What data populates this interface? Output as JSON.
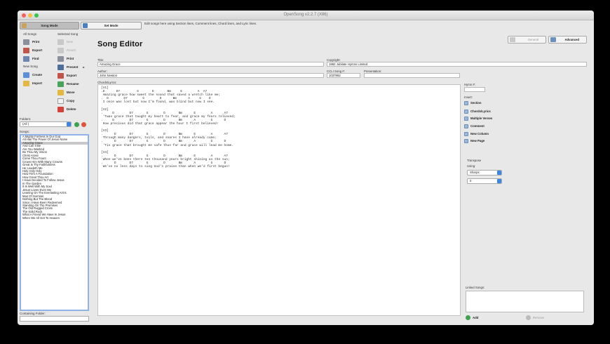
{
  "window": {
    "title": "OpenSong v2.2.7 (X86)"
  },
  "modes": {
    "song_mode": "Song Mode",
    "set_mode": "Set Mode",
    "hint": "Edit songs here using Section lines, Comment lines, Chord lines, and Lyric lines."
  },
  "left": {
    "all_songs": "All Songs",
    "selected_song": "Selected Song",
    "all_buttons": [
      "Print",
      "Export",
      "Find"
    ],
    "new_song": "New Song",
    "new_buttons": [
      "Create",
      "Import"
    ],
    "selected_buttons": [
      "New",
      "Revert",
      "Print",
      "Present",
      "Export",
      "Rename",
      "Move",
      "Copy",
      "Delete"
    ],
    "folders_label": "Folders:",
    "folder_value": "(All )",
    "songs_label": "Songs:",
    "songs": [
      "A Mighty Fortress Is Our God",
      "All Hail The Power Of Jesus Name",
      "Amazing Grace",
      "And Can It Be",
      "Are You Washed",
      "Be Thou My Vision",
      "Christ Arose",
      "Come Thou Fount",
      "Crown Him With Many Crowns",
      "Great Is Thy Faithfulness",
      "He Leadeth Me",
      "Holy Holy Holy",
      "How Firm A Foundation",
      "How Great Thou Art",
      "I Have Decided To Follow Jesus",
      "In The Garden",
      "It Is Well With My Soul",
      "Jesus Loves Even Me",
      "Leaning On The Everlasting Arms",
      "Man Of Sorrows",
      "Nothing But The Blood",
      "Since I Have Been Redeemed",
      "Standing On The Promises",
      "The Old Rugged Cross",
      "The Solid Rock",
      "What A Friend We Have In Jesus",
      "When We All Get To Heaven"
    ],
    "selected_index": 2,
    "containing_folder": "Containing Folder:"
  },
  "editor": {
    "heading": "Song Editor",
    "general": "General",
    "advanced": "Advanced",
    "title_label": "Title:",
    "title_value": "Amazing Grace",
    "author_label": "Author:",
    "author_value": "John Newton",
    "copyright_label": "Copyright:",
    "copyright_value": "1982 Jubilate Hymns Limited",
    "ccli_label": "CCLI Song #:",
    "ccli_value": "1037882",
    "presentation_label": "Presentation:",
    "presentation_value": "",
    "chords_label": "Chords/Lyrics:",
    "lyrics": "[V1]\n.D      D7         G       D       Bm     E        A  A7\n Amazing grace how sweet the sound that saved a wretch like me;\n.  D        D7        G        D      Bm      A     G    D\n I once was lost but now I'm found, was blind but now I see.\n\n[V2]\n.     D        D7       G        D       Bm      E        A      A7\n 'Twas grace that taught my heart to fear, and grace my fears relieved;\n.     D        D7       G        D       Bm      A        G      D\n How precious did that grace appear the hour I first believed!\n\n[V3]\n.      D       D7       G        D       Bm      E        A      A7\n Through many dangers, toils, and snares I have already come;\n.      D       D7       G        D       Bm      A        G      D\n 'Tis grace that brought me safe thus far and grace will lead me home.\n\n[V4]\n.      D       D7       G        D       Bm      E        A      A7\n When we've been there ten thousand years bright shining as the sun;\n.      D       D7       G        D       Bm      A        G      D\n We've no less days to sing God's praise than when we'd first begun!"
  },
  "right": {
    "hymn_label": "Hymn #:",
    "insert_label": "Insert:",
    "insert_items": [
      "Section",
      "Chords/Lyrics",
      "Multiple Verses",
      "Comment",
      "New Column",
      "New Page"
    ],
    "transpose_label": "Transpose",
    "using_label": "Using:",
    "using_value": "Sharps",
    "transpose_value": "0",
    "linked_label": "Linked Songs:",
    "add": "Add",
    "remove": "Remove"
  }
}
